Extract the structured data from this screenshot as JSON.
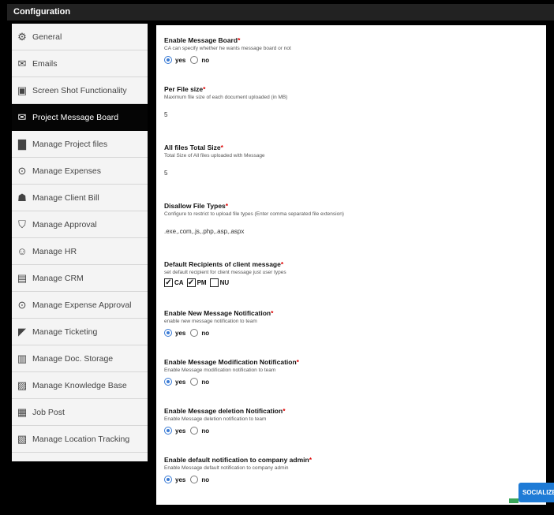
{
  "header": {
    "title": "Configuration"
  },
  "sidebar": {
    "items": [
      {
        "label": "General",
        "icon": "gear-icon",
        "glyph": "⚙",
        "active": false
      },
      {
        "label": "Emails",
        "icon": "envelope-icon",
        "glyph": "✉",
        "active": false
      },
      {
        "label": "Screen Shot Functionality",
        "icon": "camera-icon",
        "glyph": "▣",
        "active": false
      },
      {
        "label": "Project Message Board",
        "icon": "message-board-icon",
        "glyph": "✉",
        "active": true
      },
      {
        "label": "Manage Project files",
        "icon": "folder-icon",
        "glyph": "▇",
        "active": false
      },
      {
        "label": "Manage Expenses",
        "icon": "money-icon",
        "glyph": "⊙",
        "active": false
      },
      {
        "label": "Manage Client Bill",
        "icon": "client-bill-icon",
        "glyph": "☗",
        "active": false
      },
      {
        "label": "Manage Approval",
        "icon": "shield-check-icon",
        "glyph": "⛉",
        "active": false
      },
      {
        "label": "Manage HR",
        "icon": "hr-icon",
        "glyph": "☺",
        "active": false
      },
      {
        "label": "Manage CRM",
        "icon": "crm-icon",
        "glyph": "▤",
        "active": false
      },
      {
        "label": "Manage Expense Approval",
        "icon": "expense-approval-icon",
        "glyph": "⊙",
        "active": false
      },
      {
        "label": "Manage Ticketing",
        "icon": "megaphone-icon",
        "glyph": "◤",
        "active": false
      },
      {
        "label": "Manage Doc. Storage",
        "icon": "storage-icon",
        "glyph": "▥",
        "active": false
      },
      {
        "label": "Manage Knowledge Base",
        "icon": "book-icon",
        "glyph": "▨",
        "active": false
      },
      {
        "label": "Job Post",
        "icon": "job-post-icon",
        "glyph": "▦",
        "active": false
      },
      {
        "label": "Manage Location Tracking",
        "icon": "map-icon",
        "glyph": "▧",
        "active": false
      }
    ]
  },
  "form": {
    "enable_message_board": {
      "title": "Enable Message Board",
      "desc": "CA can specify whether he wants message board or not",
      "yes": "yes",
      "no": "no",
      "selected": "yes"
    },
    "per_file_size": {
      "title": "Per File size",
      "desc": "Maximum file size of each document uploaded (in MB)",
      "value": "5"
    },
    "all_files_total_size": {
      "title": "All files Total Size",
      "desc": "Total Size of All files uploaded with Message",
      "value": "5"
    },
    "disallow_file_types": {
      "title": "Disallow File Types",
      "desc": "Configure to restrict to upload file types (Enter comma separated file extension)",
      "value": ".exe,.com,.js,.php,.asp,.aspx"
    },
    "default_recipients": {
      "title": "Default Recipients of client message",
      "desc": "set default recipient for client message just user types",
      "options": [
        {
          "label": "CA",
          "checked": true
        },
        {
          "label": "PM",
          "checked": true
        },
        {
          "label": "NU",
          "checked": false
        }
      ]
    },
    "new_message_notification": {
      "title": "Enable New Message Notification",
      "desc": "enable new message notification to team",
      "yes": "yes",
      "no": "no",
      "selected": "yes"
    },
    "modification_notification": {
      "title": "Enable Message Modification Notification",
      "desc": "Enable Message modification notification to team",
      "yes": "yes",
      "no": "no",
      "selected": "yes"
    },
    "deletion_notification": {
      "title": "Enable Message deletion Notification",
      "desc": "Enable Message deletion notification to team",
      "yes": "yes",
      "no": "no",
      "selected": "yes"
    },
    "company_admin_notification": {
      "title": "Enable default notification to company admin",
      "desc": "Enable Message default notification to company admin",
      "yes": "yes",
      "no": "no",
      "selected": "yes"
    }
  },
  "social_button": {
    "label": "SOCIALIZE"
  },
  "colors": {
    "accent": "#3a7bd5",
    "required": "#dd0000",
    "social": "#1e7bd6"
  }
}
